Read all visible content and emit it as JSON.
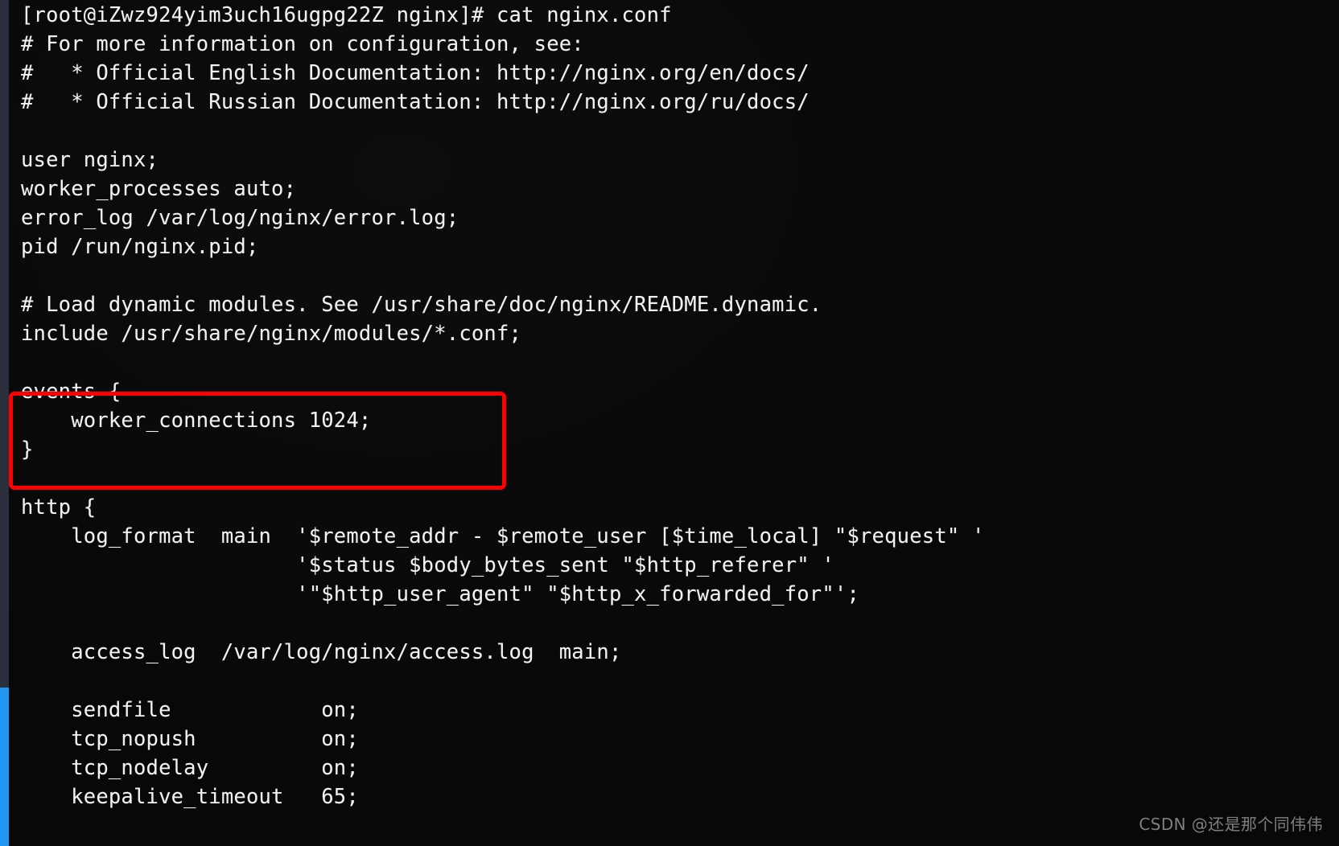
{
  "terminal": {
    "app": "ssh-terminal",
    "background_color": "#080808",
    "foreground_color": "#f2f2f2",
    "prompt": {
      "user": "root",
      "host": "iZwz924yim3uch16ugpg22Z",
      "cwd": "nginx",
      "symbol": "#",
      "command": "cat nginx.conf",
      "full_line": "[root@iZwz924yim3uch16ugpg22Z nginx]# cat nginx.conf"
    },
    "lines": [
      "[root@iZwz924yim3uch16ugpg22Z nginx]# cat nginx.conf",
      "# For more information on configuration, see:",
      "#   * Official English Documentation: http://nginx.org/en/docs/",
      "#   * Official Russian Documentation: http://nginx.org/ru/docs/",
      "",
      "user nginx;",
      "worker_processes auto;",
      "error_log /var/log/nginx/error.log;",
      "pid /run/nginx.pid;",
      "",
      "# Load dynamic modules. See /usr/share/doc/nginx/README.dynamic.",
      "include /usr/share/nginx/modules/*.conf;",
      "",
      "events {",
      "    worker_connections 1024;",
      "}",
      "",
      "http {",
      "    log_format  main  '$remote_addr - $remote_user [$time_local] \"$request\" '",
      "                      '$status $body_bytes_sent \"$http_referer\" '",
      "                      '\"$http_user_agent\" \"$http_x_forwarded_for\"';",
      "",
      "    access_log  /var/log/nginx/access.log  main;",
      "",
      "    sendfile            on;",
      "    tcp_nopush          on;",
      "    tcp_nodelay         on;",
      "    keepalive_timeout   65;"
    ]
  },
  "highlight": {
    "label": "events-block-highlight",
    "color": "#ff0000",
    "target_text": "events { worker_connections 1024; }",
    "border_width_px": 5
  },
  "scrollbar": {
    "orientation": "vertical",
    "position": "left",
    "track_color": "#2b2e3c",
    "thumb_color": "#2196f3"
  },
  "watermark": {
    "text": "CSDN @还是那个同伟伟",
    "color": "#9a9a9a"
  }
}
